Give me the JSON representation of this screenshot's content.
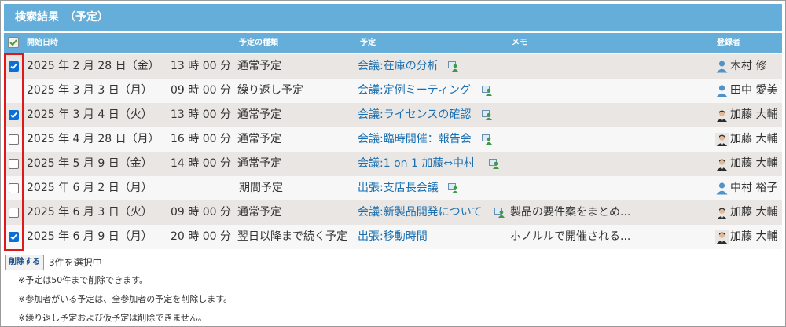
{
  "title": "検索結果　（予定）",
  "headers": {
    "start_date": "開始日時",
    "type": "予定の種類",
    "schedule": "予定",
    "memo": "メモ",
    "registrant": "登録者"
  },
  "rows": [
    {
      "checked": true,
      "date": "2025 年 2 月 28 日（金）",
      "time": "13 時 00 分",
      "type": "通常予定",
      "title": "会議:在庫の分析",
      "memo": "",
      "registrant": "木村 修",
      "avatar": "generic-user-icon",
      "has_attachment": true
    },
    {
      "checked": null,
      "date": "2025 年 3 月 3 日（月）",
      "time": "09 時 00 分",
      "type": "繰り返し予定",
      "title": "会議:定例ミーティング",
      "memo": "",
      "registrant": "田中 愛美",
      "avatar": "generic-user-icon",
      "has_attachment": true
    },
    {
      "checked": true,
      "date": "2025 年 3 月 4 日（火）",
      "time": "13 時 00 分",
      "type": "通常予定",
      "title": "会議:ライセンスの確認",
      "memo": "",
      "registrant": "加藤 大輔",
      "avatar": "photo-user-icon",
      "has_attachment": true
    },
    {
      "checked": false,
      "date": "2025 年 4 月 28 日（月）",
      "time": "16 時 00 分",
      "type": "通常予定",
      "title": "会議:臨時開催：報告会",
      "memo": "",
      "registrant": "加藤 大輔",
      "avatar": "photo-user-icon",
      "has_attachment": true
    },
    {
      "checked": false,
      "date": "2025 年 5 月 9 日（金）",
      "time": "14 時 00 分",
      "type": "通常予定",
      "title": "会議:1 on 1 加藤⇔中村",
      "memo": "",
      "registrant": "加藤 大輔",
      "avatar": "photo-user-icon",
      "has_attachment": true
    },
    {
      "checked": false,
      "date": "2025 年 6 月 2 日（月）",
      "time": "",
      "type": "期間予定",
      "title": "出張:支店長会議",
      "memo": "",
      "registrant": "中村 裕子",
      "avatar": "generic-user-icon",
      "has_attachment": true
    },
    {
      "checked": false,
      "date": "2025 年 6 月 3 日（火）",
      "time": "09 時 00 分",
      "type": "通常予定",
      "title": "会議:新製品開発について",
      "memo": "製品の要件案をまとめ...",
      "registrant": "加藤 大輔",
      "avatar": "photo-user-icon",
      "has_attachment": true
    },
    {
      "checked": true,
      "date": "2025 年 6 月 9 日（月）",
      "time": "20 時 00 分",
      "type": "翌日以降まで続く予定",
      "title": "出張:移動時間",
      "memo": "ホノルルで開催される...",
      "registrant": "加藤 大輔",
      "avatar": "photo-user-icon",
      "has_attachment": false
    }
  ],
  "delete_button": "削除する",
  "selection_count": "3件を選択中",
  "notes": [
    "※予定は50件まで削除できます。",
    "※参加者がいる予定は、全参加者の予定を削除します。",
    "※繰り返し予定および仮予定は削除できません。"
  ],
  "colors": {
    "header_blue": "#65aed9",
    "link_blue": "#1a6fb0",
    "highlight_red": "#e0181b"
  }
}
